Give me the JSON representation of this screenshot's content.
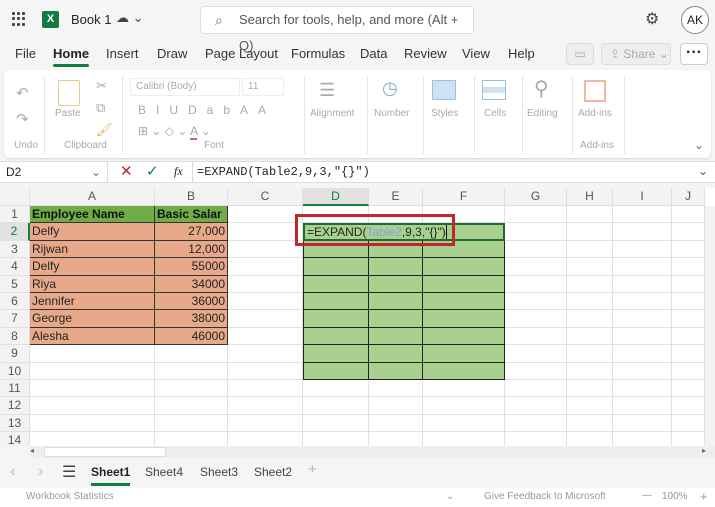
{
  "titlebar": {
    "app_name": "Book 1",
    "search_placeholder": "Search for tools, help, and more (Alt + Q)",
    "user_initials": "AK"
  },
  "menu": [
    "File",
    "Home",
    "Insert",
    "Draw",
    "Page Layout",
    "Formulas",
    "Data",
    "Review",
    "View",
    "Help"
  ],
  "menu_active": "Home",
  "share_label": "Share",
  "ribbon": {
    "undo_group": "Undo",
    "paste": "Paste",
    "clipboard": "Clipboard",
    "font_name": "Calibri (Body)",
    "font_size": "11",
    "font_group": "Font",
    "alignment": "Alignment",
    "number": "Number",
    "styles": "Styles",
    "cells": "Cells",
    "editing": "Editing",
    "addins": "Add-ins",
    "addins_group": "Add-ins"
  },
  "formula_bar": {
    "name_box": "D2",
    "fx": "fx",
    "formula": "=EXPAND(Table2,9,3,\"{}\")"
  },
  "columns": [
    "A",
    "B",
    "C",
    "D",
    "E",
    "F",
    "G",
    "H",
    "I",
    "J"
  ],
  "rows": [
    "1",
    "2",
    "3",
    "4",
    "5",
    "6",
    "7",
    "8",
    "9",
    "10",
    "11",
    "12",
    "13",
    "14"
  ],
  "table": {
    "headers": [
      "Employee Name",
      "Basic Salar"
    ],
    "rows": [
      [
        "Delfy",
        "27,000"
      ],
      [
        "Rijwan",
        "12,000"
      ],
      [
        "Delfy",
        "55000"
      ],
      [
        "Riya",
        "34000"
      ],
      [
        "Jennifer",
        "36000"
      ],
      [
        "George",
        "38000"
      ],
      [
        "Alesha",
        "46000"
      ]
    ]
  },
  "edit_cell": {
    "prefix": "=EXPAND(",
    "ref": "Table2",
    "suffix": ",9,3,\"{}\")"
  },
  "sheets": [
    "Sheet1",
    "Sheet4",
    "Sheet3",
    "Sheet2"
  ],
  "active_sheet": "Sheet1",
  "status": {
    "left": "Workbook Statistics",
    "feedback": "Give Feedback to Microsoft",
    "zoom": "100%"
  },
  "colors": {
    "header_green": "#70ad47",
    "row_salmon": "#e8a88a",
    "spill_green": "#a9d08e",
    "accent": "#107c41",
    "highlight_red": "#c0272d"
  }
}
